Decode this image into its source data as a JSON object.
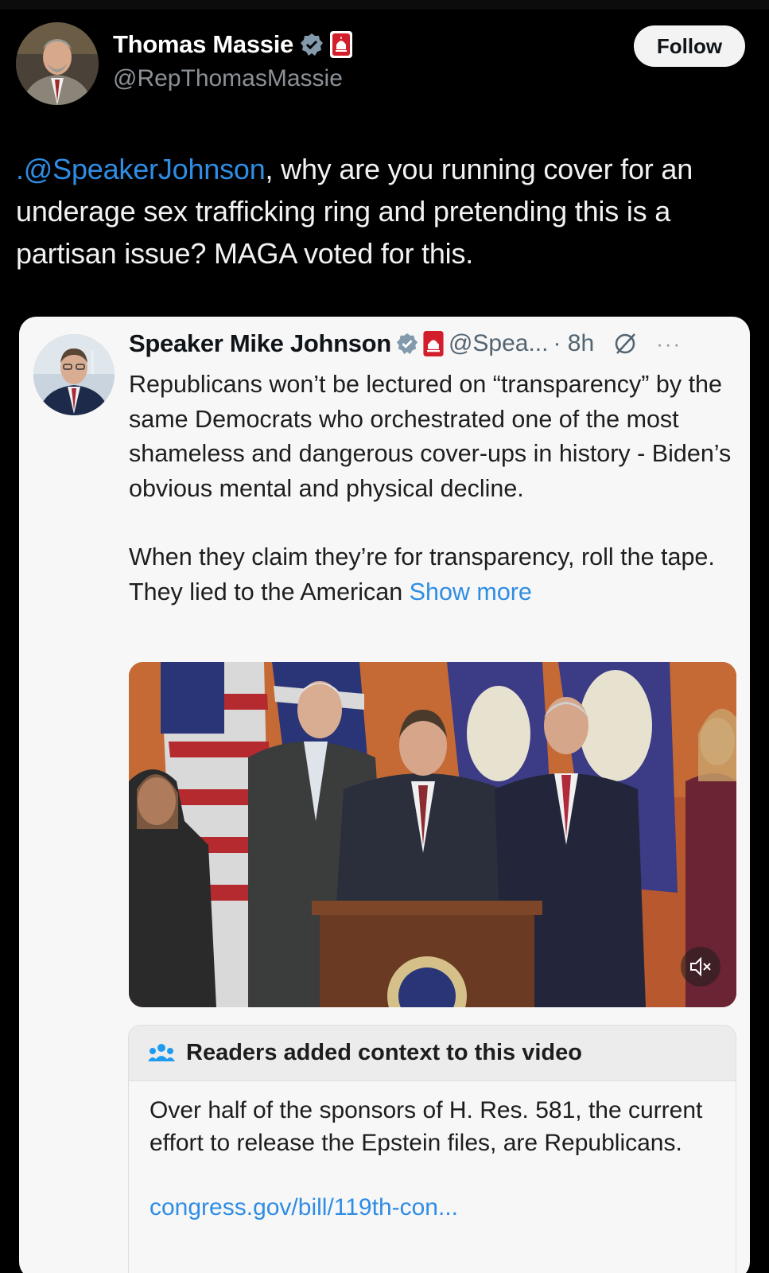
{
  "author": {
    "name": "Thomas Massie",
    "handle": "@RepThomasMassie",
    "follow_label": "Follow"
  },
  "tweet": {
    "mention": ".@SpeakerJohnson",
    "text": ", why are you running cover for an underage sex trafficking ring and pretending this is a partisan issue? MAGA voted for this."
  },
  "quote": {
    "name": "Speaker Mike Johnson",
    "handle": "@Spea...",
    "time": "· 8h",
    "more": "···",
    "paragraph1": "Republicans won’t be lectured on “transparency” by the same Democrats who orchestrated one of the most shameless and dangerous cover-ups in history - Biden’s obvious mental and physical decline.",
    "paragraph2": "When they claim they’re for transparency, roll the tape. They lied to the American ",
    "show_more": "Show more"
  },
  "context_note": {
    "title": "Readers added context to this video",
    "body": "Over half of the sponsors of H. Res. 581, the current effort to release the Epstein files, are Republicans.",
    "link": "congress.gov/bill/119th-con..."
  },
  "colors": {
    "accent": "#2f8de4",
    "background": "#000000",
    "card": "#f7f7f7"
  }
}
